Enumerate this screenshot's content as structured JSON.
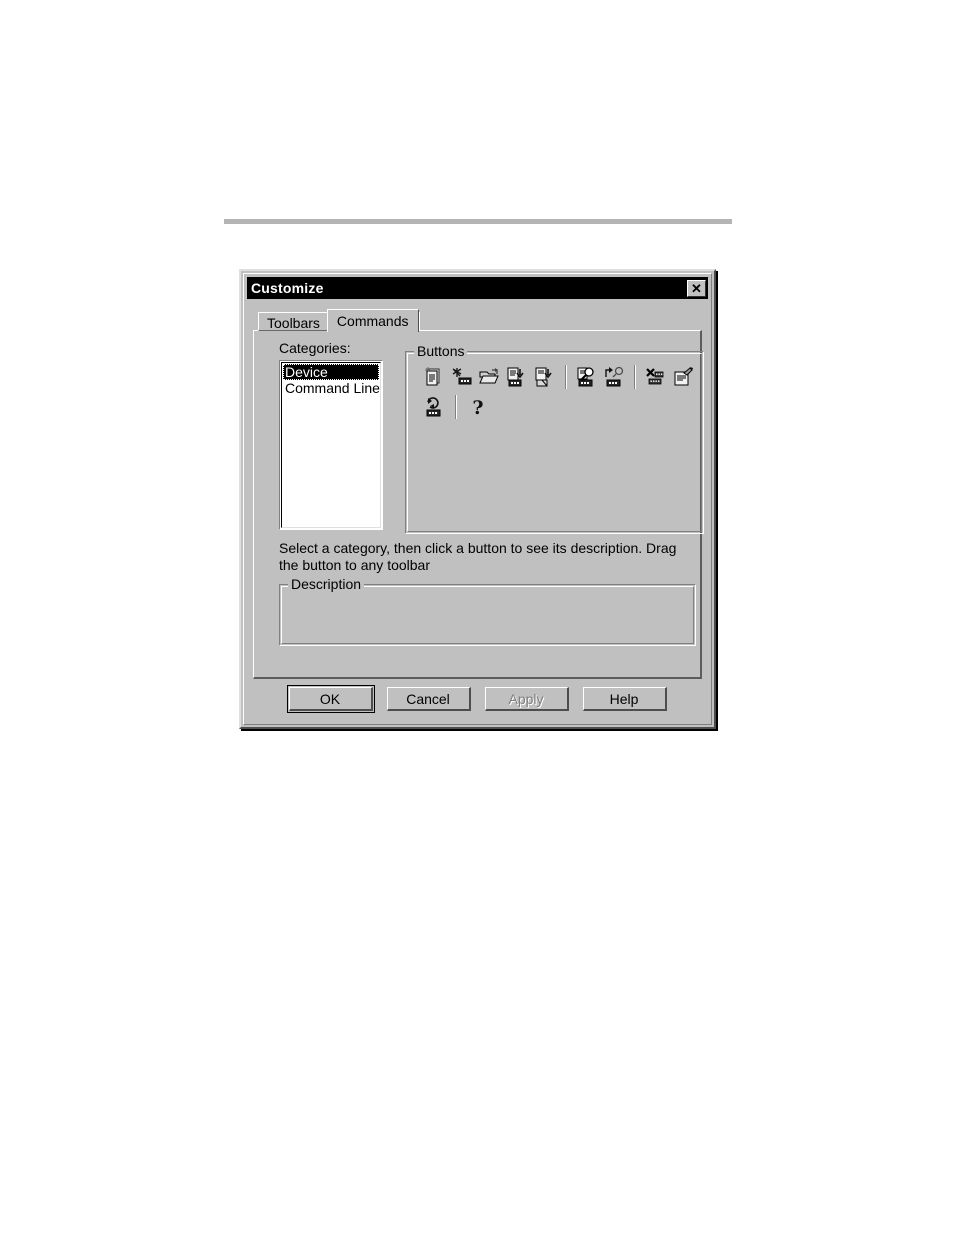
{
  "page": {
    "rule": "horizontal-divider"
  },
  "dialog": {
    "title": "Customize",
    "close_label": "✕",
    "tabs": [
      {
        "label": "Toolbars",
        "active": false
      },
      {
        "label": "Commands",
        "active": true
      }
    ],
    "categories": {
      "label": "Categories:",
      "items": [
        {
          "label": "Device",
          "selected": true
        },
        {
          "label": "Command Line",
          "selected": false
        }
      ]
    },
    "buttons_group": {
      "title": "Buttons",
      "rows": [
        {
          "cells": [
            {
              "kind": "icon",
              "name": "new-document-icon"
            },
            {
              "kind": "icon",
              "name": "new-device-icon"
            },
            {
              "kind": "icon",
              "name": "open-folder-icon"
            },
            {
              "kind": "icon",
              "name": "save-device-icon"
            },
            {
              "kind": "icon",
              "name": "export-device-icon"
            },
            {
              "kind": "separator",
              "name": "toolbar-separator"
            },
            {
              "kind": "icon",
              "name": "find-device-icon"
            },
            {
              "kind": "icon",
              "name": "connect-device-icon"
            },
            {
              "kind": "separator",
              "name": "toolbar-separator"
            },
            {
              "kind": "icon",
              "name": "delete-device-icon"
            },
            {
              "kind": "icon",
              "name": "device-properties-icon"
            }
          ]
        },
        {
          "cells": [
            {
              "kind": "icon",
              "name": "refresh-device-icon"
            },
            {
              "kind": "separator",
              "name": "toolbar-separator"
            },
            {
              "kind": "icon",
              "name": "help-icon"
            }
          ]
        }
      ]
    },
    "hint": "Select a category, then click a button to see its description. Drag the button to any toolbar",
    "description_group": {
      "title": "Description",
      "text": ""
    },
    "actions": [
      {
        "label": "OK",
        "style": "default",
        "enabled": true
      },
      {
        "label": "Cancel",
        "style": "plain",
        "enabled": true
      },
      {
        "label": "Apply",
        "style": "plain",
        "enabled": false
      },
      {
        "label": "Help",
        "style": "plain",
        "enabled": true
      }
    ]
  },
  "colors": {
    "face": "#c0c0c0",
    "titlebar": "#000000",
    "titlebar_text": "#ffffff",
    "highlight": "#000000",
    "highlight_text": "#ffffff",
    "disabled_text": "#808080",
    "rule": "#b4b4b4"
  }
}
